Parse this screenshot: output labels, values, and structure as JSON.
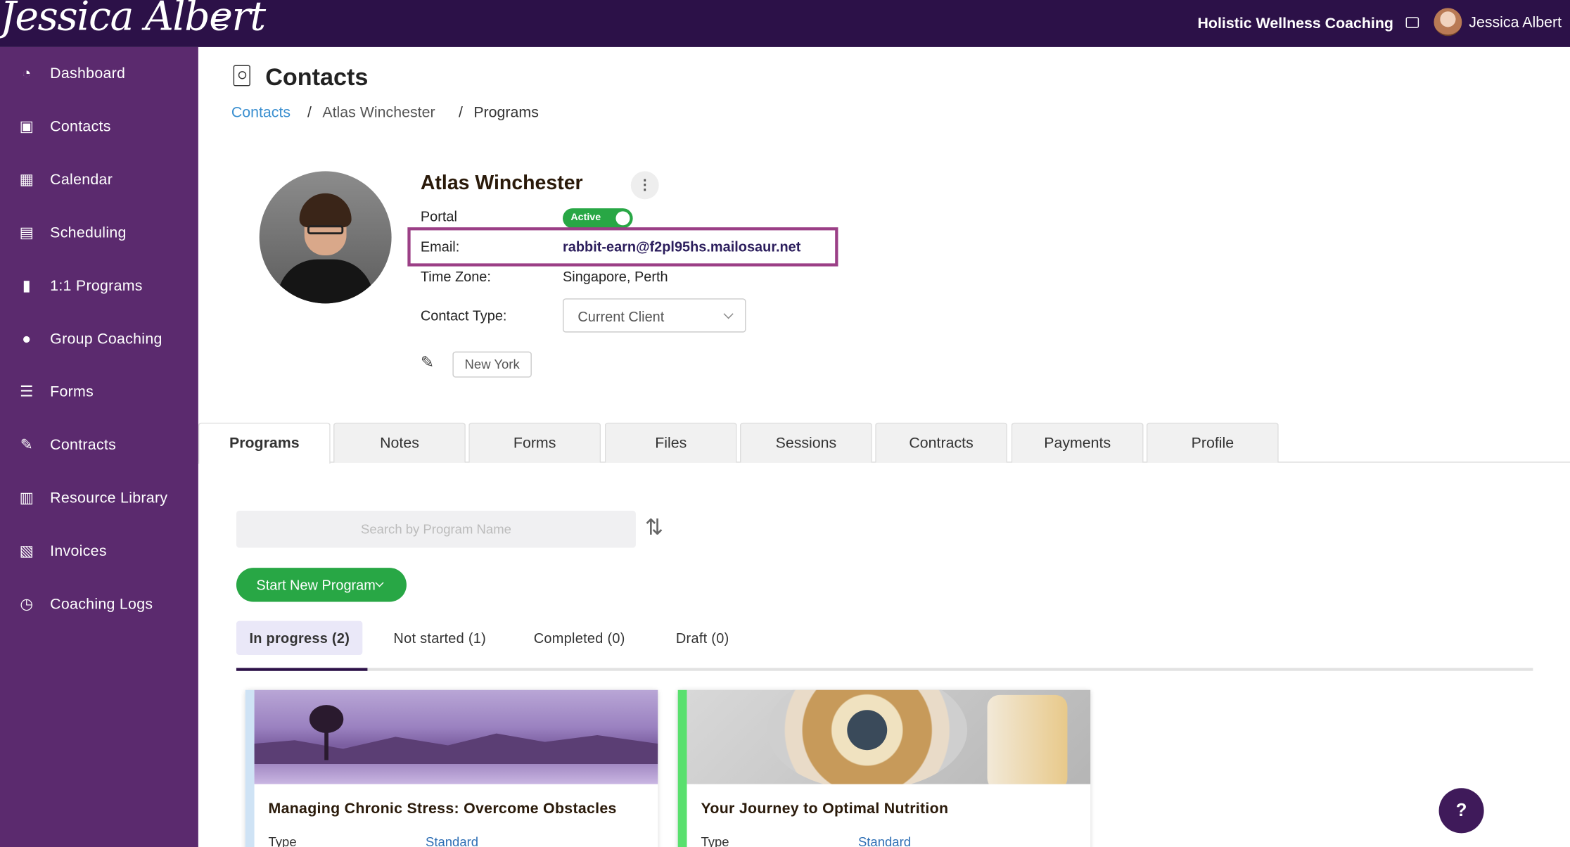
{
  "header": {
    "logo_text": "Jessica Albert",
    "business_name": "Holistic Wellness Coaching",
    "user_name": "Jessica Albert"
  },
  "sidebar": {
    "items": [
      {
        "label": "Dashboard",
        "icon": "dashboard-icon"
      },
      {
        "label": "Contacts",
        "icon": "contacts-icon"
      },
      {
        "label": "Calendar",
        "icon": "calendar-icon"
      },
      {
        "label": "Scheduling",
        "icon": "scheduling-icon"
      },
      {
        "label": "1:1 Programs",
        "icon": "book-icon"
      },
      {
        "label": "Group Coaching",
        "icon": "users-icon"
      },
      {
        "label": "Forms",
        "icon": "list-icon"
      },
      {
        "label": "Contracts",
        "icon": "signature-icon"
      },
      {
        "label": "Resource Library",
        "icon": "library-icon"
      },
      {
        "label": "Invoices",
        "icon": "invoice-icon"
      },
      {
        "label": "Coaching Logs",
        "icon": "clock-icon"
      }
    ]
  },
  "page": {
    "title": "Contacts",
    "breadcrumb": [
      "Contacts",
      "Atlas Winchester",
      "Programs"
    ],
    "separator": "/"
  },
  "contact": {
    "name": "Atlas Winchester",
    "portal_label": "Portal",
    "portal_status": "Active",
    "email_label": "Email:",
    "email": "rabbit-earn@f2pl95hs.mailosaur.net",
    "timezone_label": "Time Zone:",
    "timezone": "Singapore, Perth",
    "contact_type_label": "Contact Type:",
    "contact_type": "Current Client",
    "tag": "New York"
  },
  "tabs": [
    "Programs",
    "Notes",
    "Forms",
    "Files",
    "Sessions",
    "Contracts",
    "Payments",
    "Profile"
  ],
  "programs": {
    "search_placeholder": "Search by Program Name",
    "start_button": "Start New Program",
    "status_tabs": [
      "In progress (2)",
      "Not started (1)",
      "Completed (0)",
      "Draft (0)"
    ],
    "cards": [
      {
        "title": "Managing Chronic Stress: Overcome Obstacles",
        "type_label": "Type",
        "type_value": "Standard"
      },
      {
        "title": "Your Journey to Optimal Nutrition",
        "type_label": "Type",
        "type_value": "Standard"
      }
    ]
  },
  "help": {
    "label": "?"
  },
  "colors": {
    "topbar": "#2c1148",
    "sidebar": "#5b2a6e",
    "accent_green": "#28a745",
    "highlight": "#9b3f86"
  }
}
